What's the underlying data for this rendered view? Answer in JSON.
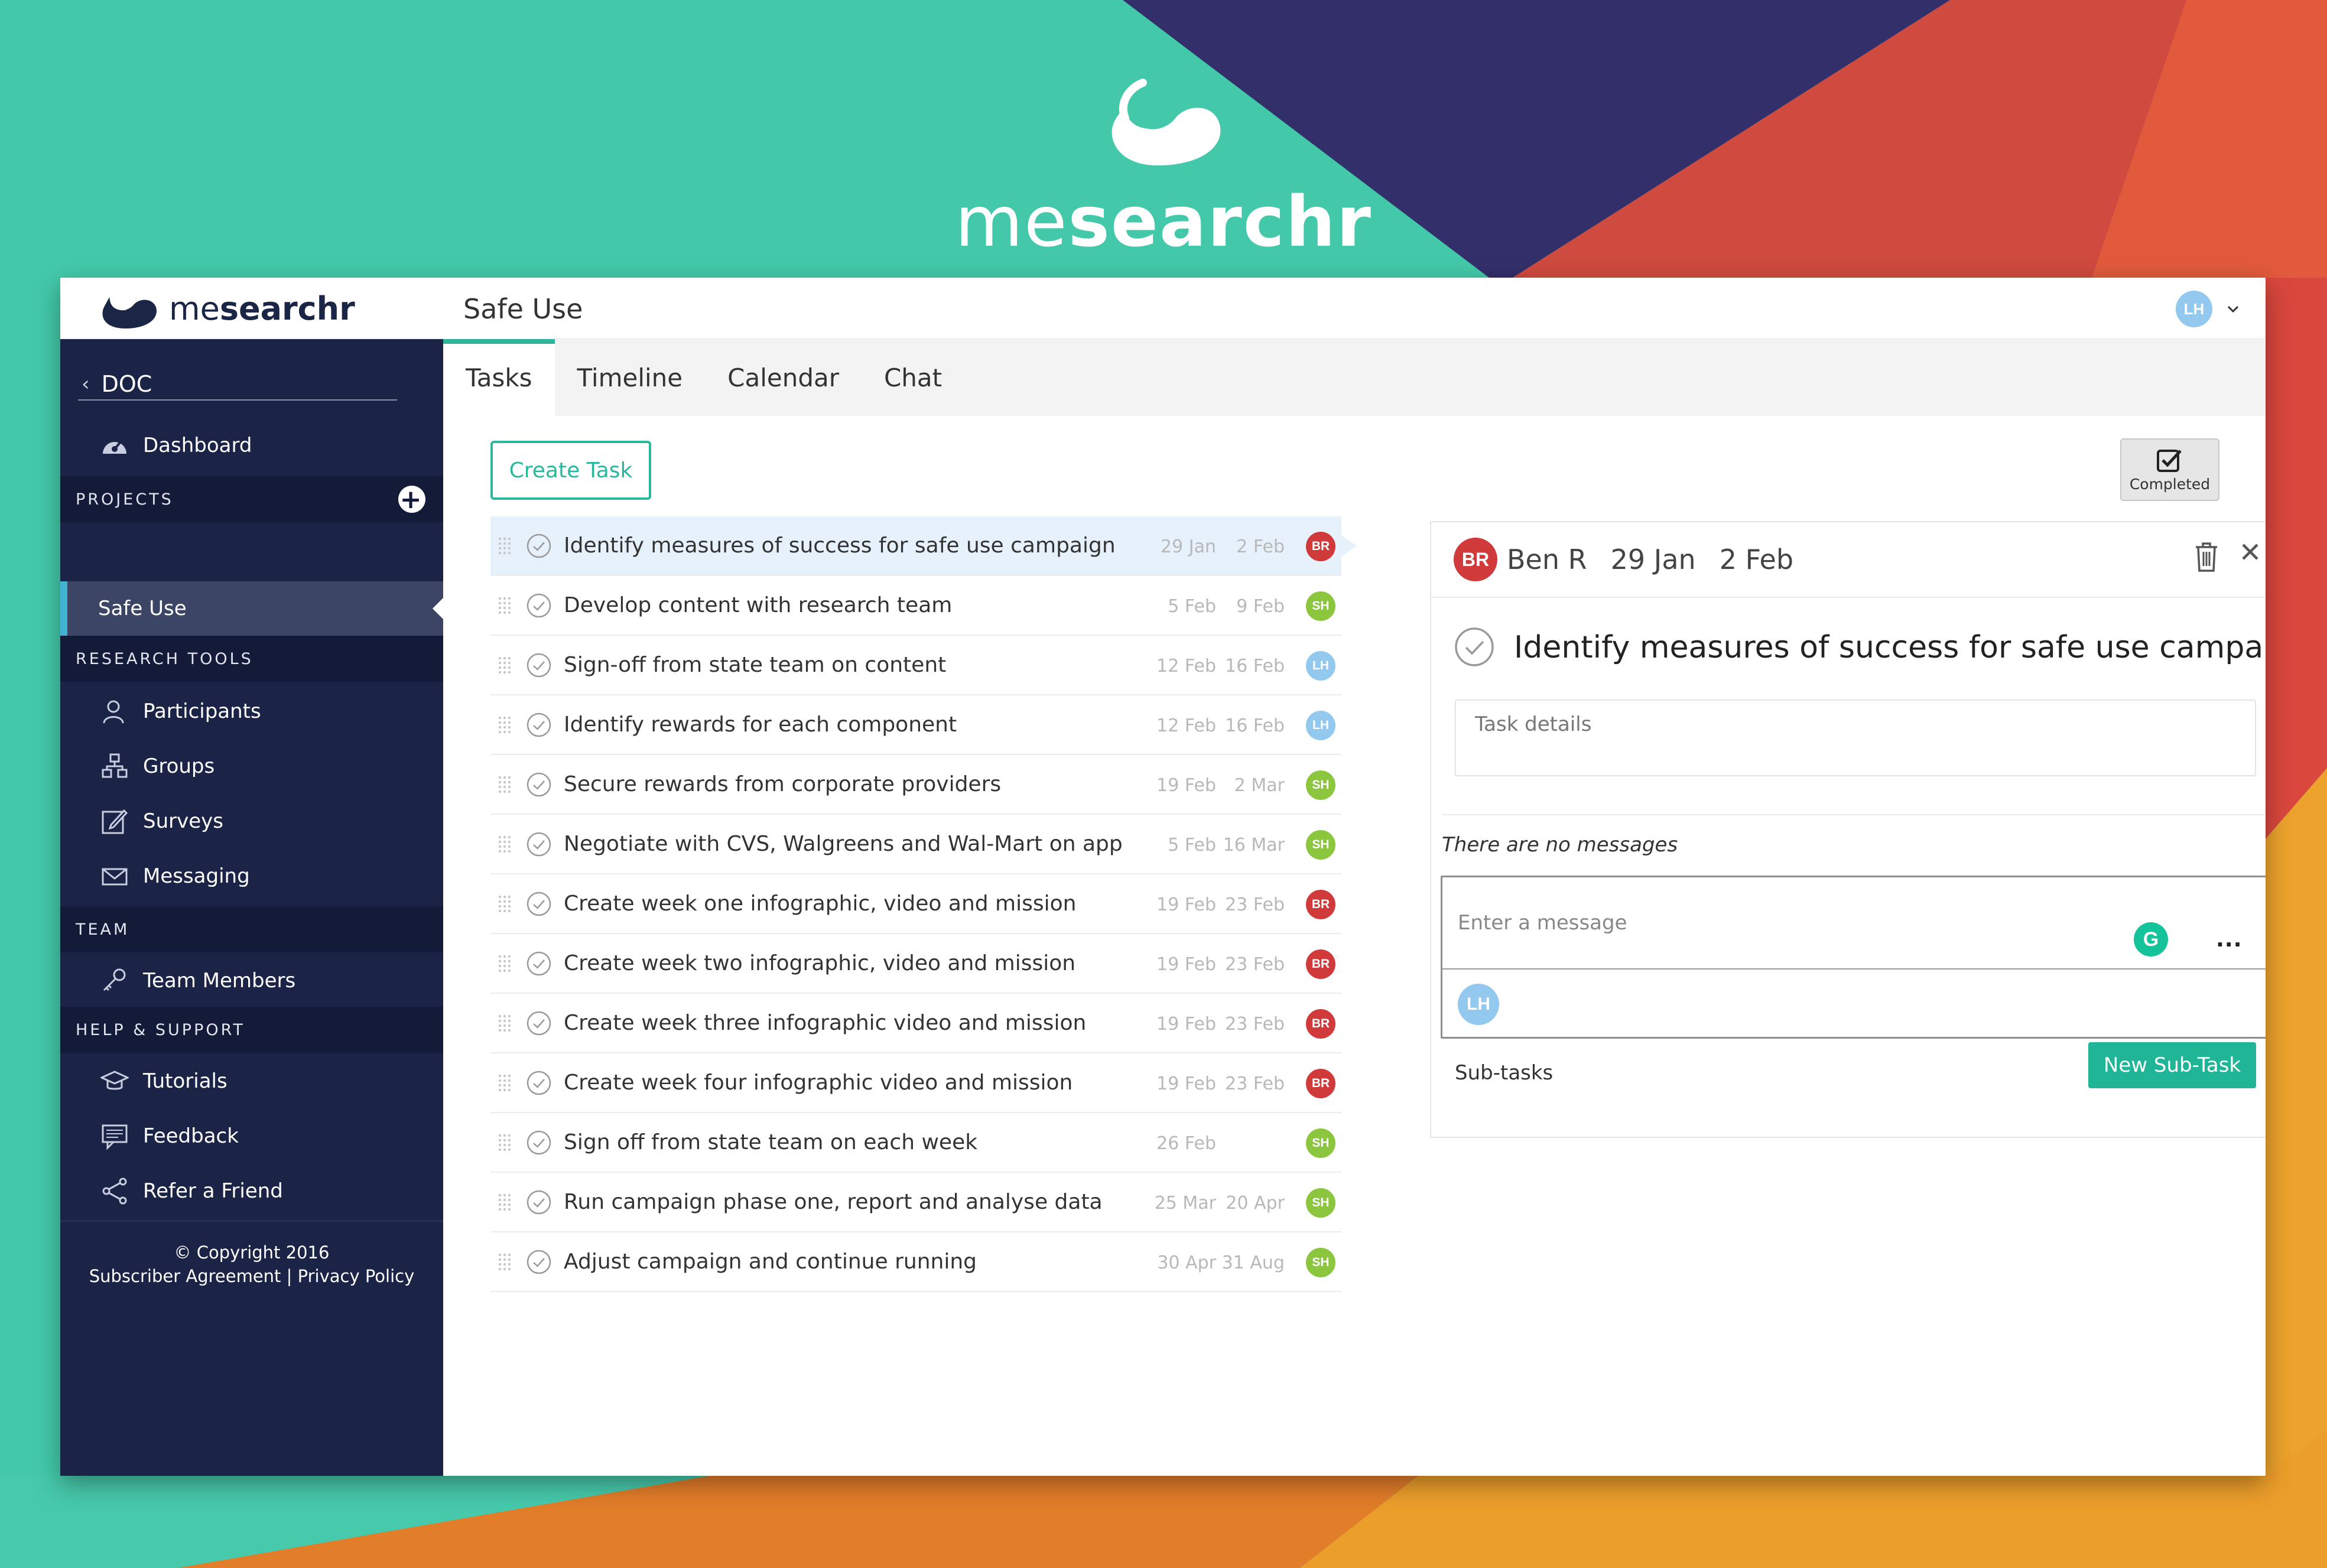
{
  "brand": {
    "name_light": "me",
    "name_bold": "searchr"
  },
  "colors": {
    "accent": "#2ab79c",
    "sidebar": "#1b2347",
    "avatar_br": "#d13a3a",
    "avatar_sh": "#8cc63f",
    "avatar_lh": "#93c9ef"
  },
  "header": {
    "project_title": "Safe Use",
    "user_initials": "LH"
  },
  "sidebar": {
    "back_label": "DOC",
    "dashboard": "Dashboard",
    "projects_heading": "PROJECTS",
    "active_project": "Safe Use",
    "research_heading": "RESEARCH TOOLS",
    "research_items": [
      "Participants",
      "Groups",
      "Surveys",
      "Messaging"
    ],
    "team_heading": "TEAM",
    "team_items": [
      "Team Members"
    ],
    "help_heading": "HELP & SUPPORT",
    "help_items": [
      "Tutorials",
      "Feedback",
      "Refer a Friend"
    ],
    "copyright": "© Copyright 2016",
    "legal": "Subscriber Agreement | Privacy Policy"
  },
  "tabs": [
    "Tasks",
    "Timeline",
    "Calendar",
    "Chat"
  ],
  "toolbar": {
    "create_task": "Create Task",
    "completed": "Completed"
  },
  "tasks": [
    {
      "title": "Identify measures of success for safe use campaign",
      "start": "29 Jan",
      "end": "2 Feb",
      "owner": "BR"
    },
    {
      "title": "Develop content with research team",
      "start": "5 Feb",
      "end": "9 Feb",
      "owner": "SH"
    },
    {
      "title": "Sign-off from state team on content",
      "start": "12 Feb",
      "end": "16 Feb",
      "owner": "LH"
    },
    {
      "title": "Identify rewards for each component",
      "start": "12 Feb",
      "end": "16 Feb",
      "owner": "LH"
    },
    {
      "title": "Secure rewards from corporate providers",
      "start": "19 Feb",
      "end": "2 Mar",
      "owner": "SH"
    },
    {
      "title": "Negotiate with CVS, Walgreens and Wal-Mart on app pre:",
      "start": "5 Feb",
      "end": "16 Mar",
      "owner": "SH"
    },
    {
      "title": "Create week one infographic, video and mission",
      "start": "19 Feb",
      "end": "23 Feb",
      "owner": "BR"
    },
    {
      "title": "Create week two infographic, video and mission",
      "start": "19 Feb",
      "end": "23 Feb",
      "owner": "BR"
    },
    {
      "title": "Create week three infographic video and mission",
      "start": "19 Feb",
      "end": "23 Feb",
      "owner": "BR"
    },
    {
      "title": "Create week four infographic video and mission",
      "start": "19 Feb",
      "end": "23 Feb",
      "owner": "BR"
    },
    {
      "title": "Sign off from state team on each week",
      "start": "26 Feb",
      "end": "",
      "owner": "SH"
    },
    {
      "title": "Run campaign phase one, report and analyse data",
      "start": "25 Mar",
      "end": "20 Apr",
      "owner": "SH"
    },
    {
      "title": "Adjust campaign and continue running",
      "start": "30 Apr",
      "end": "31 Aug",
      "owner": "SH"
    }
  ],
  "detail": {
    "owner_initials": "BR",
    "owner_name": "Ben R",
    "start": "29 Jan",
    "end": "2 Feb",
    "title": "Identify measures of success for safe use campaign",
    "details_placeholder": "Task details",
    "no_messages": "There are no messages",
    "message_placeholder": "Enter a message",
    "grammarly_letter": "G",
    "more": "...",
    "commenter_initials": "LH",
    "subtasks_label": "Sub-tasks",
    "new_subtask": "New Sub-Task"
  }
}
